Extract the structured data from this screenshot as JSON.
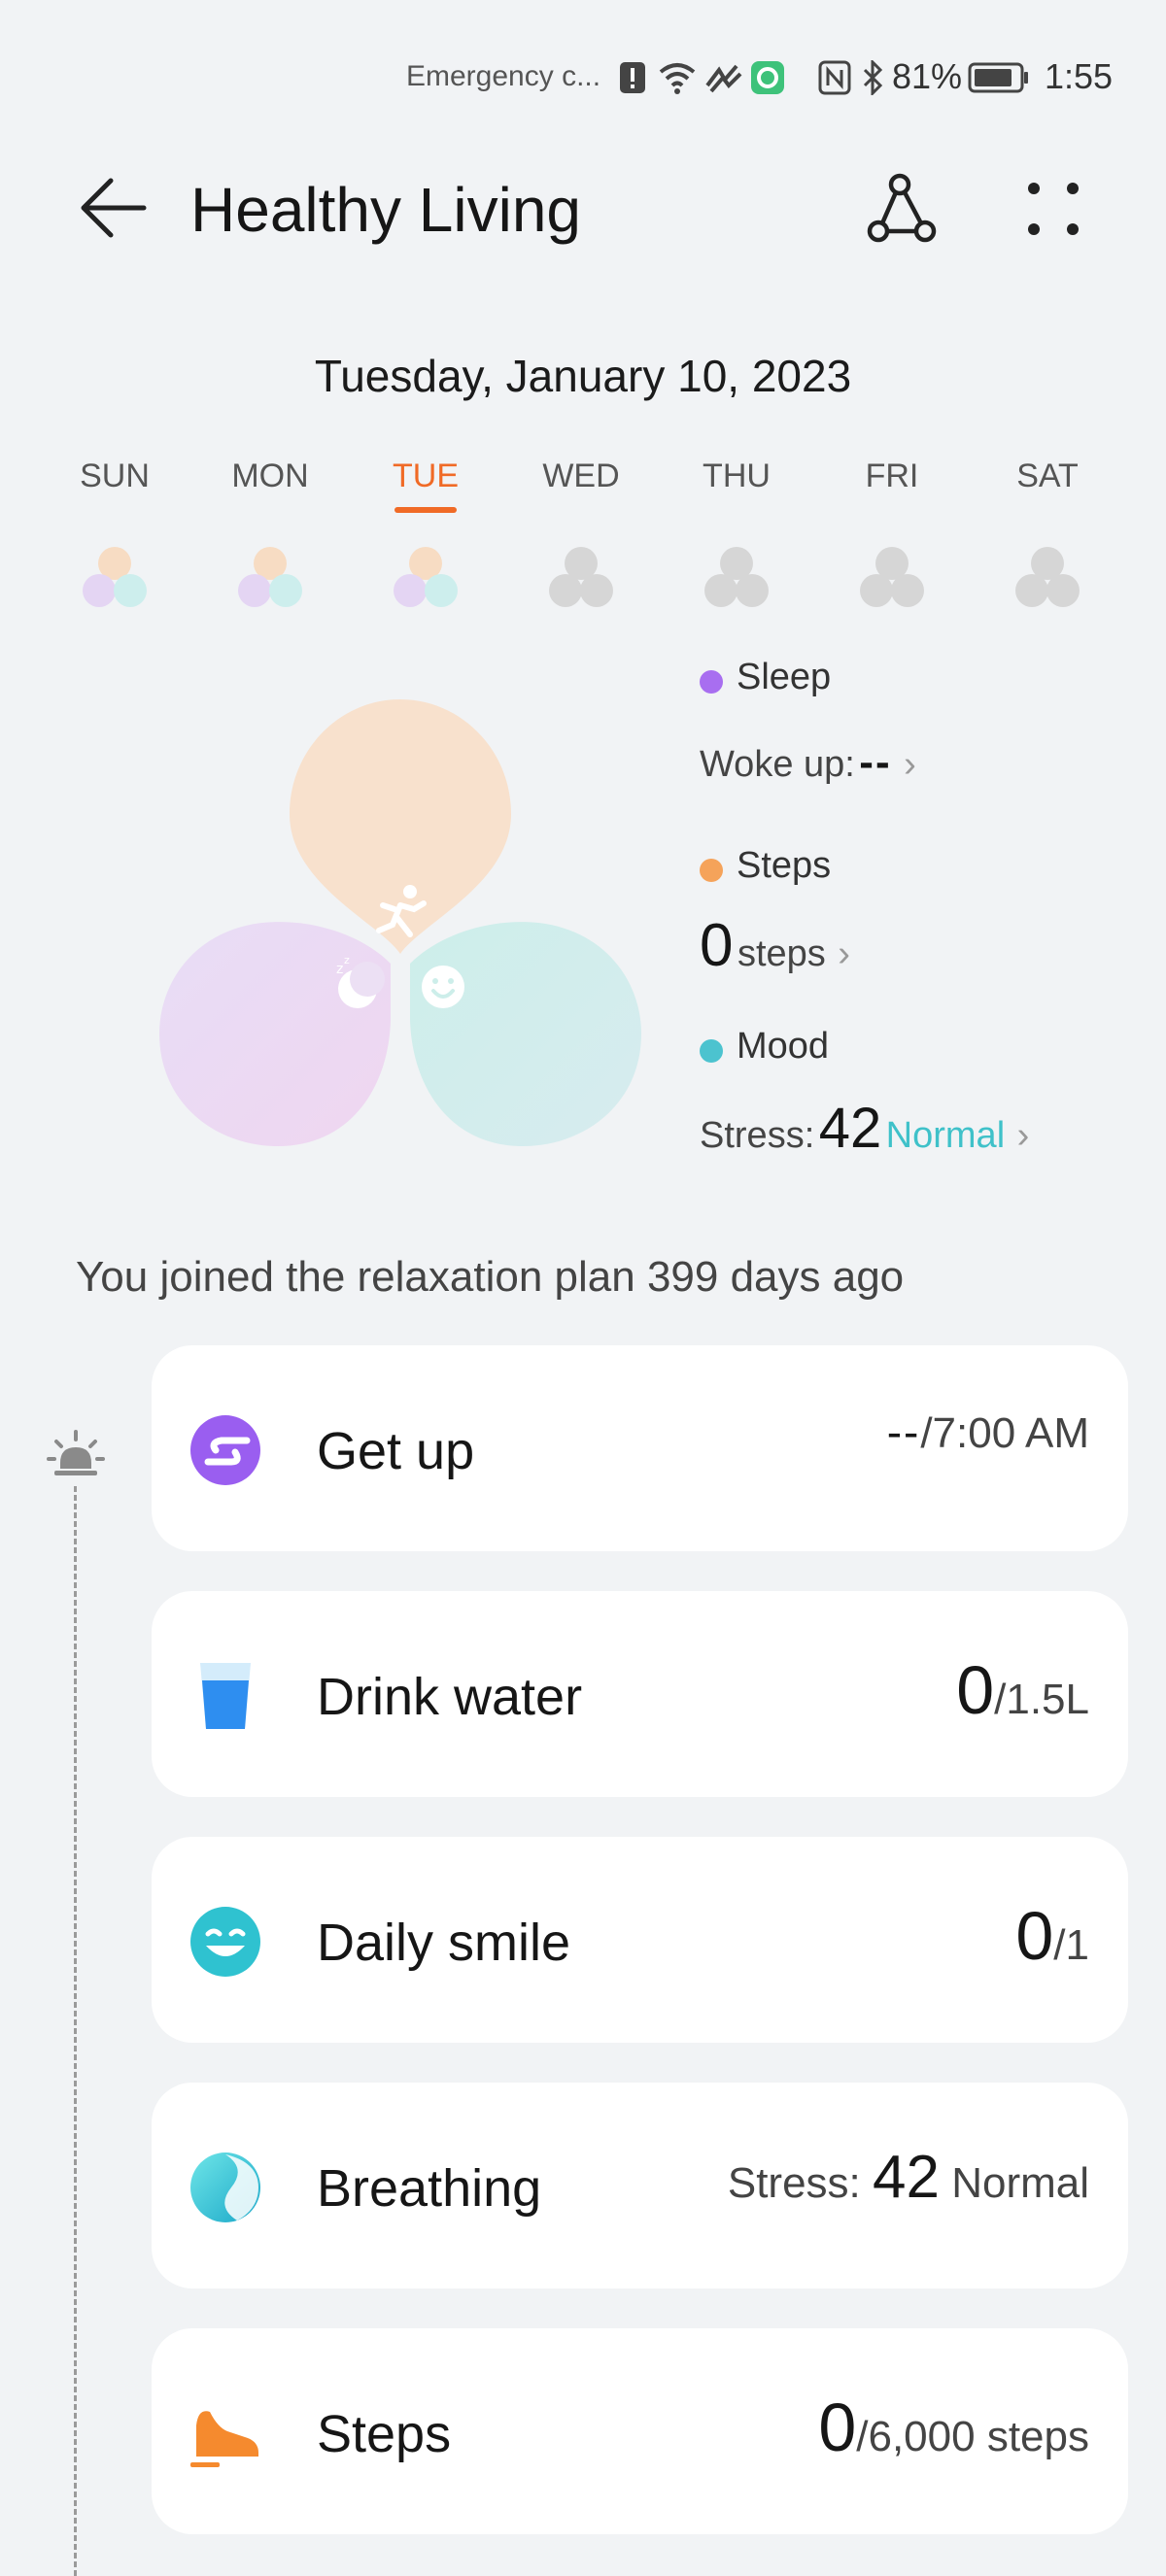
{
  "status_bar": {
    "carrier": "Emergency c...",
    "battery_pct": "81%",
    "time": "1:55"
  },
  "header": {
    "title": "Healthy Living"
  },
  "date_heading": "Tuesday, January 10, 2023",
  "week": [
    {
      "label": "SUN",
      "filled": true
    },
    {
      "label": "MON",
      "filled": true
    },
    {
      "label": "TUE",
      "filled": true,
      "active": true
    },
    {
      "label": "WED",
      "filled": false
    },
    {
      "label": "THU",
      "filled": false
    },
    {
      "label": "FRI",
      "filled": false
    },
    {
      "label": "SAT",
      "filled": false
    }
  ],
  "colors": {
    "sleep": "#a86ef0",
    "steps": "#f5a35a",
    "mood": "#4cc3cf",
    "accent": "#f06a26",
    "normal": "#3fc1c9"
  },
  "legend": {
    "sleep": {
      "name": "Sleep",
      "label": "Woke up:",
      "value": "--"
    },
    "steps": {
      "name": "Steps",
      "value": "0",
      "unit": "steps"
    },
    "mood": {
      "name": "Mood",
      "label": "Stress:",
      "value": "42",
      "status": "Normal"
    }
  },
  "joined_text": "You joined the relaxation plan 399 days ago",
  "cards": [
    {
      "title": "Get up",
      "value": "--",
      "suffix": "/7:00 AM",
      "icon": "get-up-icon"
    },
    {
      "title": "Drink water",
      "value": "0",
      "suffix": "/1.5L",
      "icon": "water-glass-icon"
    },
    {
      "title": "Daily smile",
      "value": "0",
      "suffix": "/1",
      "icon": "smile-icon"
    },
    {
      "title": "Breathing",
      "prefix": "Stress: ",
      "value": "42",
      "suffix": " Normal",
      "icon": "breathing-icon"
    },
    {
      "title": "Steps",
      "value": "0",
      "suffix": "/6,000 steps",
      "icon": "sneaker-icon"
    }
  ]
}
